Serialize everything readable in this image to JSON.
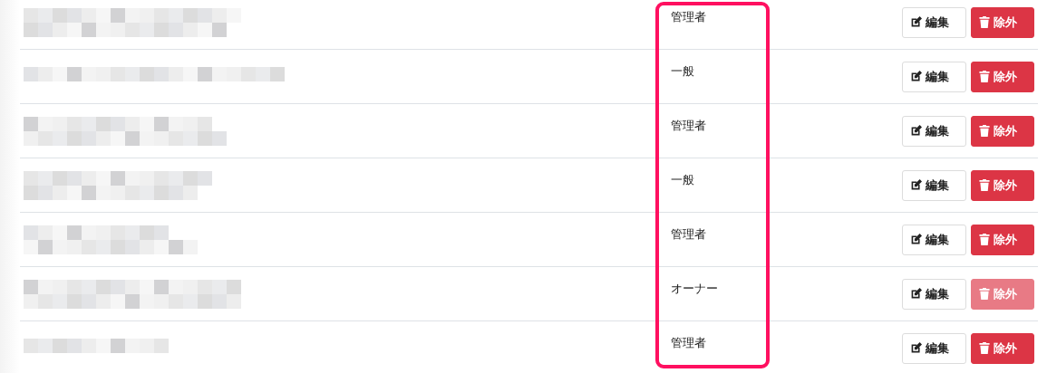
{
  "role_column_highlighted": true,
  "rows": [
    {
      "role": "管理者",
      "edit_label": "編集",
      "remove_label": "除外",
      "remove_disabled": false
    },
    {
      "role": "一般",
      "edit_label": "編集",
      "remove_label": "除外",
      "remove_disabled": false
    },
    {
      "role": "管理者",
      "edit_label": "編集",
      "remove_label": "除外",
      "remove_disabled": false
    },
    {
      "role": "一般",
      "edit_label": "編集",
      "remove_label": "除外",
      "remove_disabled": false
    },
    {
      "role": "管理者",
      "edit_label": "編集",
      "remove_label": "除外",
      "remove_disabled": false
    },
    {
      "role": "オーナー",
      "edit_label": "編集",
      "remove_label": "除外",
      "remove_disabled": true
    },
    {
      "role": "管理者",
      "edit_label": "編集",
      "remove_label": "除外",
      "remove_disabled": false
    }
  ]
}
